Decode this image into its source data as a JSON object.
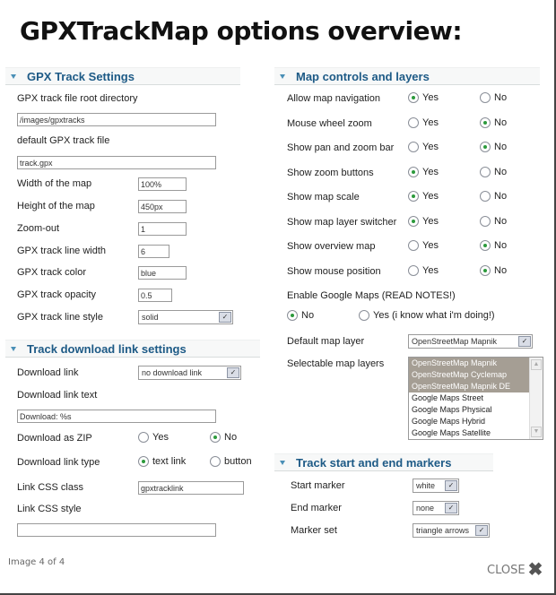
{
  "title": "GPXTrackMap options overview:",
  "gpx_track_settings": {
    "header": "GPX Track Settings",
    "root_dir_label": "GPX track file root directory",
    "root_dir_value": "/images/gpxtracks",
    "default_file_label": "default GPX track file",
    "default_file_value": "track.gpx",
    "width_label": "Width of the map",
    "width_value": "100%",
    "height_label": "Height of the map",
    "height_value": "450px",
    "zoomout_label": "Zoom-out",
    "zoomout_value": "1",
    "line_width_label": "GPX track line width",
    "line_width_value": "6",
    "color_label": "GPX track color",
    "color_value": "blue",
    "opacity_label": "GPX track opacity",
    "opacity_value": "0.5",
    "line_style_label": "GPX track line style",
    "line_style_value": "solid"
  },
  "download_settings": {
    "header": "Track download link settings",
    "link_label": "Download link",
    "link_value": "no download link",
    "text_label": "Download link text",
    "text_value": "Download: %s",
    "zip_label": "Download as ZIP",
    "zip_yes": "Yes",
    "zip_no": "No",
    "zip_selected": "No",
    "type_label": "Download link type",
    "type_text": "text link",
    "type_button": "button",
    "type_selected": "text link",
    "css_class_label": "Link CSS class",
    "css_class_value": "gpxtracklink",
    "css_style_label": "Link CSS style",
    "css_style_value": ""
  },
  "map_controls": {
    "header": "Map controls and layers",
    "yes": "Yes",
    "no": "No",
    "rows": [
      {
        "label": "Allow map navigation",
        "selected": "Yes"
      },
      {
        "label": "Mouse wheel zoom",
        "selected": "No"
      },
      {
        "label": "Show pan and zoom bar",
        "selected": "No"
      },
      {
        "label": "Show zoom buttons",
        "selected": "Yes"
      },
      {
        "label": "Show map scale",
        "selected": "Yes"
      },
      {
        "label": "Show map layer switcher",
        "selected": "Yes"
      },
      {
        "label": "Show overview map",
        "selected": "No"
      },
      {
        "label": "Show mouse position",
        "selected": "No"
      }
    ],
    "google_label": "Enable Google Maps (READ NOTES!)",
    "google_no": "No",
    "google_yes": "Yes (i know what i'm doing!)",
    "google_selected": "No",
    "default_layer_label": "Default map layer",
    "default_layer_value": "OpenStreetMap Mapnik",
    "selectable_label": "Selectable map layers",
    "layers": [
      {
        "name": "OpenStreetMap Mapnik",
        "selected": true
      },
      {
        "name": "OpenStreetMap Cyclemap",
        "selected": true
      },
      {
        "name": "OpenStreetMap Mapnik DE",
        "selected": true
      },
      {
        "name": "Google Maps Street",
        "selected": false
      },
      {
        "name": "Google Maps Physical",
        "selected": false
      },
      {
        "name": "Google Maps Hybrid",
        "selected": false
      },
      {
        "name": "Google Maps Satellite",
        "selected": false
      }
    ]
  },
  "markers": {
    "header": "Track start and end markers",
    "start_label": "Start marker",
    "start_value": "white",
    "end_label": "End marker",
    "end_value": "none",
    "set_label": "Marker set",
    "set_value": "triangle arrows"
  },
  "footer": {
    "counter": "Image 4 of 4",
    "close": "CLOSE"
  },
  "colors": {
    "section_header": "#1d5a86",
    "radio_checked": "#2c9a3c",
    "selected_option": "#a59e94"
  }
}
